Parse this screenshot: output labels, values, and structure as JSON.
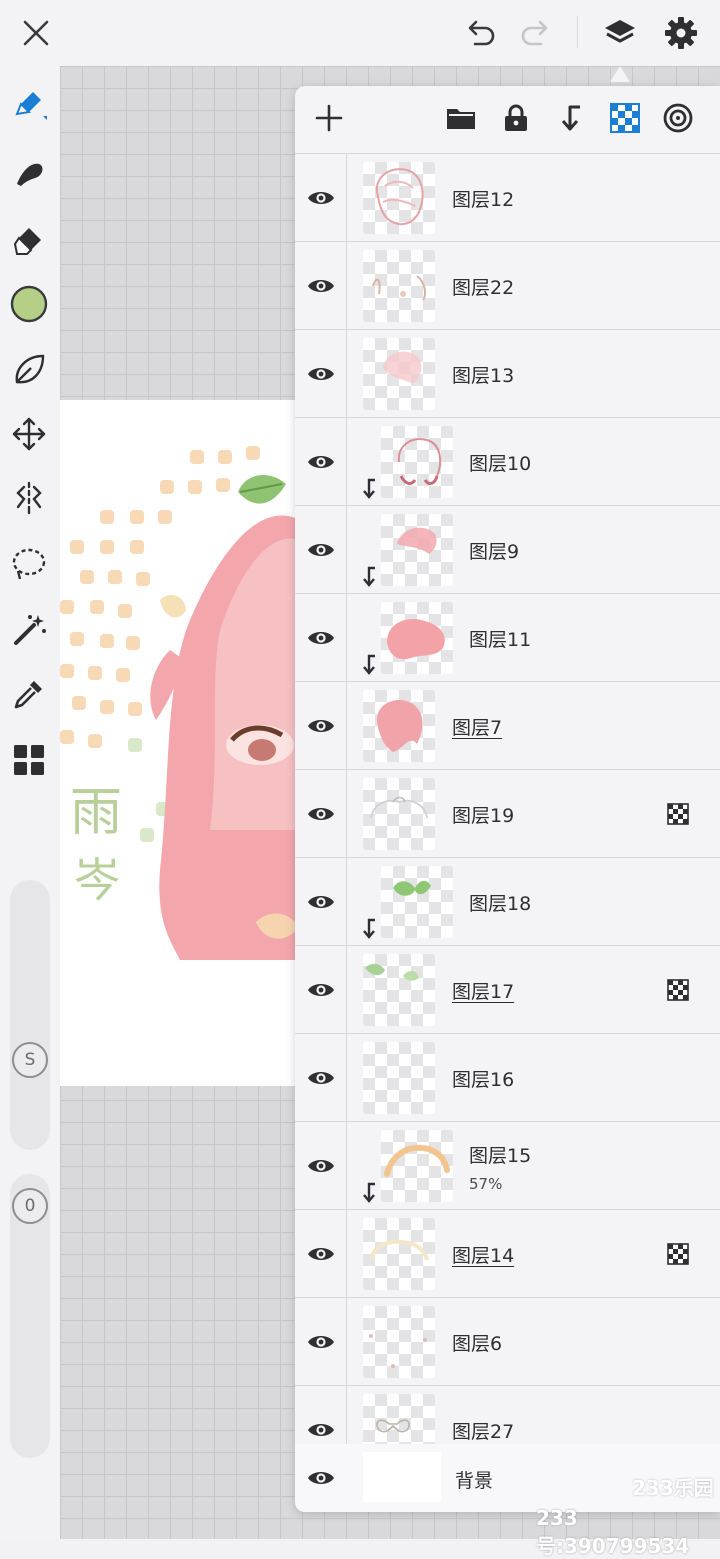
{
  "topbar": {
    "close_icon": "close-icon",
    "undo_icon": "undo-icon",
    "redo_icon": "redo-icon",
    "layers_icon": "layers-icon",
    "settings_icon": "gear-icon"
  },
  "tools": [
    "brush-icon",
    "smudge-icon",
    "eraser-icon",
    "color-swatch",
    "fill-leaf-icon",
    "transform-icon",
    "symmetry-icon",
    "lasso-icon",
    "magic-wand-icon",
    "eyedropper-icon",
    "gallery-grid-icon"
  ],
  "colors": {
    "current_color": "#b5cf87",
    "accent": "#1a7fd4"
  },
  "sliders": {
    "size_badge": "S",
    "opacity_badge": "0"
  },
  "artwork": {
    "text_top": "雨",
    "text_bottom": "岑"
  },
  "layer_panel": {
    "header_icons": [
      "add-icon",
      "folder-icon",
      "lock-icon",
      "clip-icon",
      "alpha-checker-icon",
      "target-icon"
    ],
    "layers": [
      {
        "name": "图层12",
        "clipped": false,
        "underlined": false,
        "alpha_lock": false,
        "opacity": ""
      },
      {
        "name": "图层22",
        "clipped": false,
        "underlined": false,
        "alpha_lock": false,
        "opacity": ""
      },
      {
        "name": "图层13",
        "clipped": false,
        "underlined": false,
        "alpha_lock": false,
        "opacity": ""
      },
      {
        "name": "图层10",
        "clipped": true,
        "underlined": false,
        "alpha_lock": false,
        "opacity": ""
      },
      {
        "name": "图层9",
        "clipped": true,
        "underlined": false,
        "alpha_lock": false,
        "opacity": ""
      },
      {
        "name": "图层11",
        "clipped": true,
        "underlined": false,
        "alpha_lock": false,
        "opacity": ""
      },
      {
        "name": "图层7",
        "clipped": false,
        "underlined": true,
        "alpha_lock": false,
        "opacity": ""
      },
      {
        "name": "图层19",
        "clipped": false,
        "underlined": false,
        "alpha_lock": true,
        "opacity": ""
      },
      {
        "name": "图层18",
        "clipped": true,
        "underlined": false,
        "alpha_lock": false,
        "opacity": ""
      },
      {
        "name": "图层17",
        "clipped": false,
        "underlined": true,
        "alpha_lock": true,
        "opacity": ""
      },
      {
        "name": "图层16",
        "clipped": false,
        "underlined": false,
        "alpha_lock": false,
        "opacity": ""
      },
      {
        "name": "图层15",
        "clipped": true,
        "underlined": false,
        "alpha_lock": false,
        "opacity": "57%"
      },
      {
        "name": "图层14",
        "clipped": false,
        "underlined": true,
        "alpha_lock": true,
        "opacity": ""
      },
      {
        "name": "图层6",
        "clipped": false,
        "underlined": false,
        "alpha_lock": false,
        "opacity": ""
      },
      {
        "name": "图层27",
        "clipped": false,
        "underlined": false,
        "alpha_lock": false,
        "opacity": ""
      }
    ],
    "background_layer": "背景"
  },
  "watermarks": {
    "site": "233乐园",
    "id": "233号:390799534"
  }
}
